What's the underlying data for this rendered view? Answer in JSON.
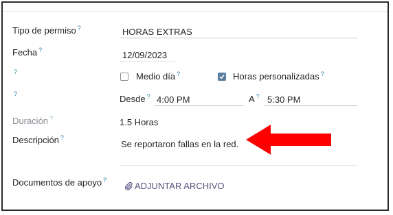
{
  "form": {
    "leave_type": {
      "label": "Tipo de permiso",
      "hint": "?",
      "value": "HORAS EXTRAS"
    },
    "date": {
      "label": "Fecha",
      "hint": "?",
      "value": "12/09/2023"
    },
    "options_row": {
      "hint": "?",
      "half_day": {
        "label": "Medio día",
        "hint": "?",
        "checked": false
      },
      "custom_hours": {
        "label": "Horas personalizadas",
        "hint": "?",
        "checked": true
      }
    },
    "time_row": {
      "hint": "?",
      "from_label": "Desde",
      "from_hint": "?",
      "from_value": "4:00 PM",
      "to_label": "A",
      "to_hint": "?",
      "to_value": "5:30 PM"
    },
    "duration": {
      "label": "Duración",
      "hint": "?",
      "value": "1.5 Horas"
    },
    "description": {
      "label": "Descripción",
      "hint": "?",
      "value": "Se reportaron fallas en la red."
    },
    "documents": {
      "label": "Documentos de apoyo",
      "hint": "?",
      "button_label": "ADJUNTAR ARCHIVO"
    }
  },
  "colors": {
    "annotation_arrow": "#ff0000",
    "checkbox_checked": "#5a7f9e",
    "hint_marker": "#2a7fa6",
    "attach_link": "#5a4f7c"
  },
  "icons": {
    "attach": "paperclip-icon",
    "annotation": "red-arrow-left"
  }
}
